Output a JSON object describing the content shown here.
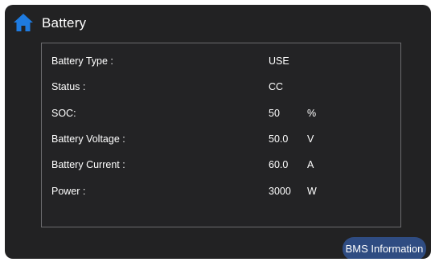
{
  "header": {
    "title": "Battery",
    "home_icon": "home-icon"
  },
  "colors": {
    "background": "#222223",
    "panel_border": "#6b6b6e",
    "home_icon": "#1e7be0",
    "button": "#2f4c82",
    "text": "#ffffff"
  },
  "battery_info": {
    "rows": [
      {
        "label": "Battery Type :",
        "value": "USE",
        "unit": ""
      },
      {
        "label": "Status :",
        "value": "CC",
        "unit": ""
      },
      {
        "label": "SOC:",
        "value": "50",
        "unit": "%"
      },
      {
        "label": "Battery Voltage :",
        "value": "50.0",
        "unit": "V"
      },
      {
        "label": "Battery Current :",
        "value": "60.0",
        "unit": "A"
      },
      {
        "label": "Power :",
        "value": "3000",
        "unit": "W"
      }
    ]
  },
  "footer": {
    "bms_button_label": "BMS Information"
  }
}
